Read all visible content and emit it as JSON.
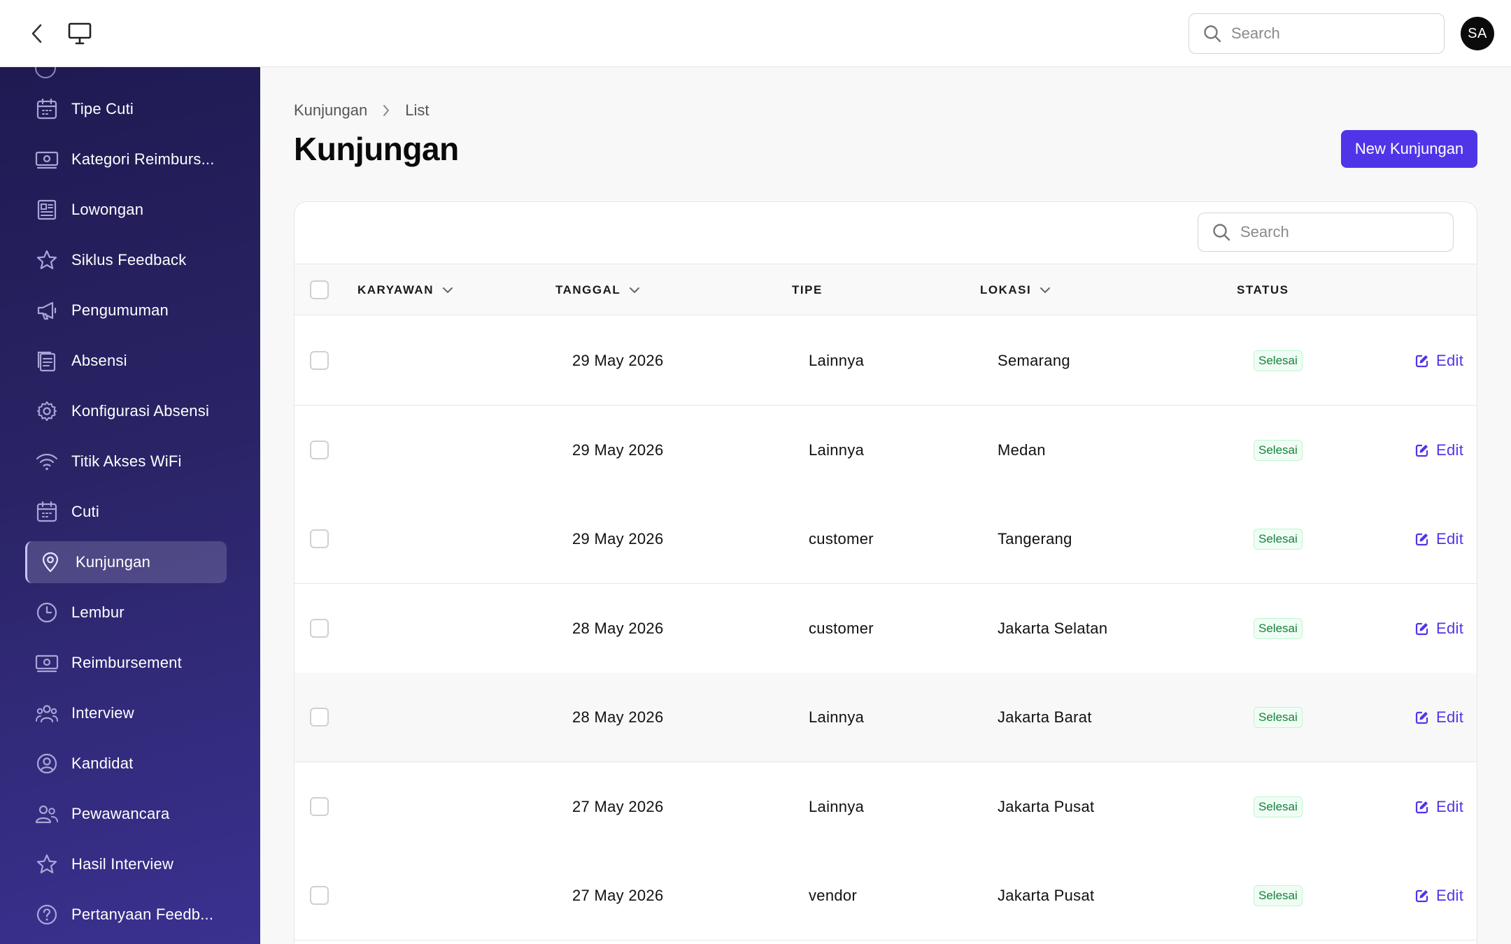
{
  "topbar": {
    "search_placeholder": "Search",
    "avatar_initials": "SA"
  },
  "sidebar": {
    "items": [
      {
        "label": "Tipe Cuti",
        "icon": "calendar-icon",
        "active": false
      },
      {
        "label": "Kategori Reimburs...",
        "icon": "banknote-icon",
        "active": false
      },
      {
        "label": "Lowongan",
        "icon": "newspaper-icon",
        "active": false
      },
      {
        "label": "Siklus Feedback",
        "icon": "star-icon",
        "active": false
      },
      {
        "label": "Pengumuman",
        "icon": "megaphone-icon",
        "active": false
      },
      {
        "label": "Absensi",
        "icon": "clipboard-icon",
        "active": false
      },
      {
        "label": "Konfigurasi Absensi",
        "icon": "gear-icon",
        "active": false
      },
      {
        "label": "Titik Akses WiFi",
        "icon": "wifi-icon",
        "active": false
      },
      {
        "label": "Cuti",
        "icon": "calendar-icon",
        "active": false
      },
      {
        "label": "Kunjungan",
        "icon": "map-pin-icon",
        "active": true
      },
      {
        "label": "Lembur",
        "icon": "clock-icon",
        "active": false
      },
      {
        "label": "Reimbursement",
        "icon": "banknote-icon",
        "active": false
      },
      {
        "label": "Interview",
        "icon": "user-group-icon",
        "active": false
      },
      {
        "label": "Kandidat",
        "icon": "user-circle-icon",
        "active": false
      },
      {
        "label": "Pewawancara",
        "icon": "users-icon",
        "active": false
      },
      {
        "label": "Hasil Interview",
        "icon": "star-icon",
        "active": false
      },
      {
        "label": "Pertanyaan Feedb...",
        "icon": "question-circle-icon",
        "active": false
      }
    ]
  },
  "breadcrumb": {
    "parent": "Kunjungan",
    "current": "List"
  },
  "page": {
    "title": "Kunjungan",
    "new_button": "New Kunjungan"
  },
  "table": {
    "search_placeholder": "Search",
    "headers": {
      "karyawan": "KARYAWAN",
      "tanggal": "TANGGAL",
      "tipe": "TIPE",
      "lokasi": "LOKASI",
      "status": "STATUS"
    },
    "edit_label": "Edit",
    "rows": [
      {
        "karyawan": "",
        "tanggal": "29 May 2026",
        "tipe": "Lainnya",
        "lokasi": "Semarang",
        "status": "Selesai"
      },
      {
        "karyawan": "",
        "tanggal": "29 May 2026",
        "tipe": "Lainnya",
        "lokasi": "Medan",
        "status": "Selesai"
      },
      {
        "karyawan": "",
        "tanggal": "29 May 2026",
        "tipe": "customer",
        "lokasi": "Tangerang",
        "status": "Selesai"
      },
      {
        "karyawan": "",
        "tanggal": "28 May 2026",
        "tipe": "customer",
        "lokasi": "Jakarta Selatan",
        "status": "Selesai"
      },
      {
        "karyawan": "",
        "tanggal": "28 May 2026",
        "tipe": "Lainnya",
        "lokasi": "Jakarta Barat",
        "status": "Selesai"
      },
      {
        "karyawan": "",
        "tanggal": "27 May 2026",
        "tipe": "Lainnya",
        "lokasi": "Jakarta Pusat",
        "status": "Selesai"
      },
      {
        "karyawan": "",
        "tanggal": "27 May 2026",
        "tipe": "vendor",
        "lokasi": "Jakarta Pusat",
        "status": "Selesai"
      }
    ]
  },
  "colors": {
    "accent": "#4f35e8",
    "sidebar_top": "#1f1a52",
    "sidebar_bottom": "#3a3190",
    "status_success": "#15803d"
  }
}
